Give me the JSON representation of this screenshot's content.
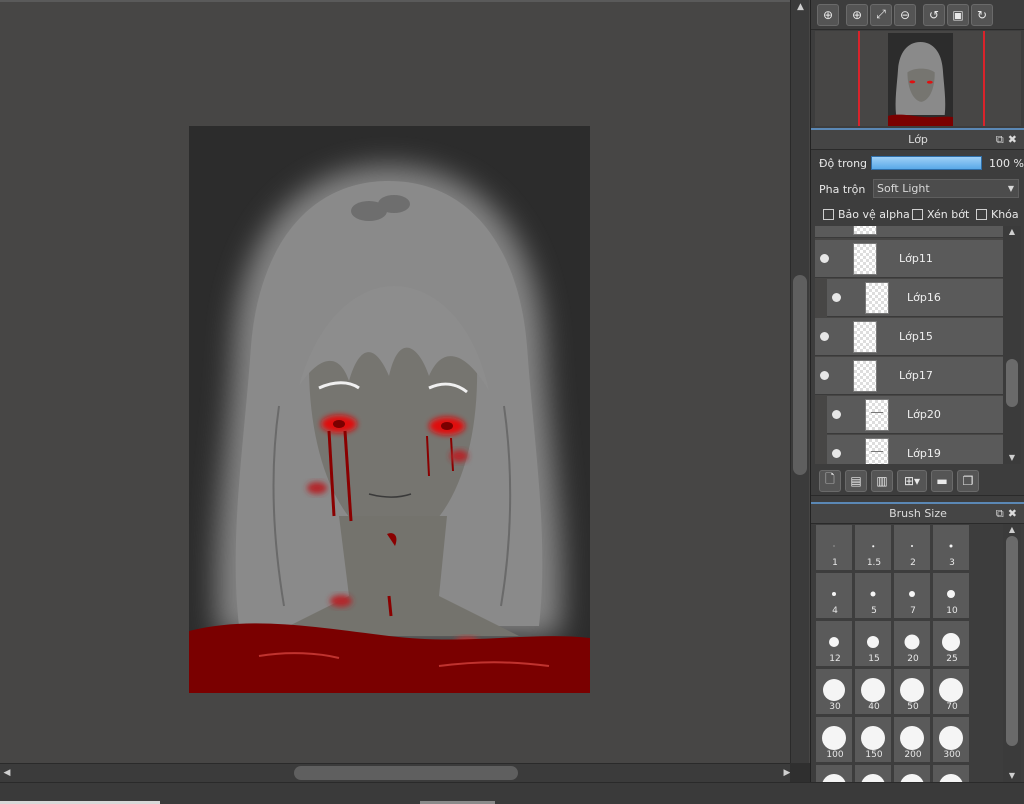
{
  "navigator_toolbar": {
    "buttons": [
      {
        "name": "zoom-fit-icon",
        "glyph": "⊕"
      },
      {
        "name": "zoom-in-icon",
        "glyph": "⊕"
      },
      {
        "name": "fit-window-icon",
        "glyph": "⤢"
      },
      {
        "name": "zoom-out-icon",
        "glyph": "⊖"
      },
      {
        "name": "rotate-left-icon",
        "glyph": "↺"
      },
      {
        "name": "reset-view-icon",
        "glyph": "▣"
      },
      {
        "name": "rotate-right-icon",
        "glyph": "↻"
      }
    ]
  },
  "layer_panel": {
    "title": "Lớp",
    "opacity_label": "Độ trong",
    "opacity_value": "100 %",
    "opacity_fraction": 1.0,
    "blend_label": "Pha trộn",
    "blend_value": "Soft Light",
    "checkboxes": {
      "protect_alpha": "Bảo vệ alpha",
      "clipping": "Xén bớt",
      "lock": "Khóa"
    },
    "layers": [
      {
        "name": "Lớp11",
        "sub": false
      },
      {
        "name": "Lớp16",
        "sub": true
      },
      {
        "name": "Lớp15",
        "sub": false
      },
      {
        "name": "Lớp17",
        "sub": false
      },
      {
        "name": "Lớp20",
        "sub": true
      },
      {
        "name": "Lớp19",
        "sub": true
      }
    ]
  },
  "brush_panel": {
    "title": "Brush Size",
    "sizes": [
      "1",
      "1.5",
      "2",
      "3",
      "4",
      "5",
      "7",
      "10",
      "12",
      "15",
      "20",
      "25",
      "30",
      "40",
      "50",
      "70",
      "100",
      "150",
      "200",
      "300"
    ]
  },
  "colors": {
    "accent": "#5b88b5",
    "navigator_frame": "#d9232b",
    "opacity_bar": "#59a9e8"
  }
}
